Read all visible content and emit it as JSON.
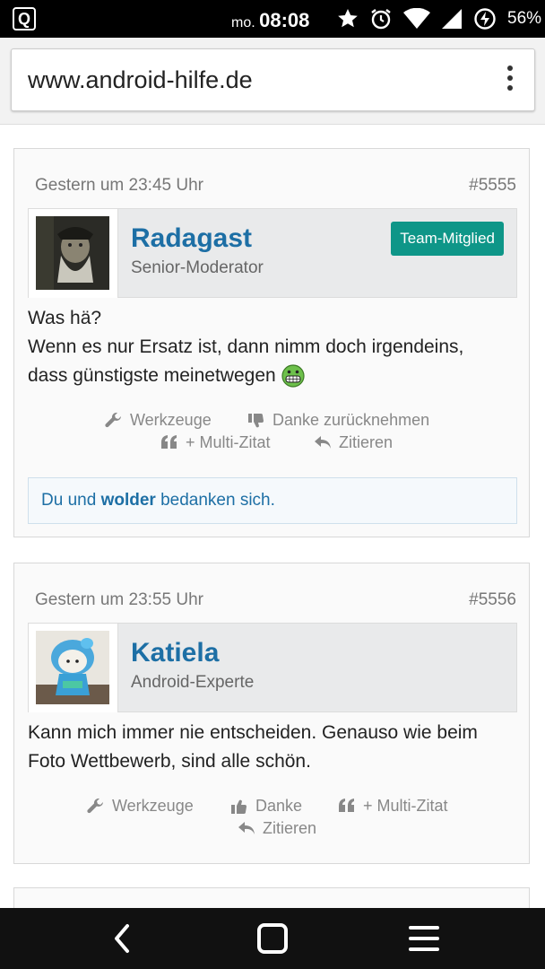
{
  "statusbar": {
    "day": "mo.",
    "time": "08:08",
    "battery": "56%",
    "icons": [
      "q-app-icon",
      "star-icon",
      "alarm-icon",
      "wifi-icon",
      "signal-icon",
      "data-saver-icon"
    ]
  },
  "browser": {
    "url": "www.android-hilfe.de"
  },
  "posts": [
    {
      "date": "Gestern um 23:45 Uhr",
      "number": "#5555",
      "author": "Radagast",
      "rank": "Senior-Moderator",
      "badge": "Team-Mitglied",
      "lines": [
        "Was hä?",
        "Wenn es nur Ersatz ist, dann nimm doch irgendeins,",
        "dass günstigste meinetwegen"
      ],
      "actions": {
        "tools": "Werkzeuge",
        "unthank": "Danke zurücknehmen",
        "multiquote": "+ Multi-Zitat",
        "quote": "Zitieren"
      },
      "thanks": {
        "you": "Du",
        "and": "und",
        "user": "wolder",
        "suffix": "bedanken sich."
      }
    },
    {
      "date": "Gestern um 23:55 Uhr",
      "number": "#5556",
      "author": "Katiela",
      "rank": "Android-Experte",
      "lines": [
        "Kann mich immer nie entscheiden. Genauso wie beim",
        "Foto Wettbewerb, sind alle schön."
      ],
      "actions": {
        "tools": "Werkzeuge",
        "thank": "Danke",
        "multiquote": "+ Multi-Zitat",
        "quote": "Zitieren"
      }
    }
  ],
  "colors": {
    "link": "#1d6fa5",
    "badge": "#0e9688",
    "statusbar": "#000000",
    "navbar": "#111111"
  }
}
